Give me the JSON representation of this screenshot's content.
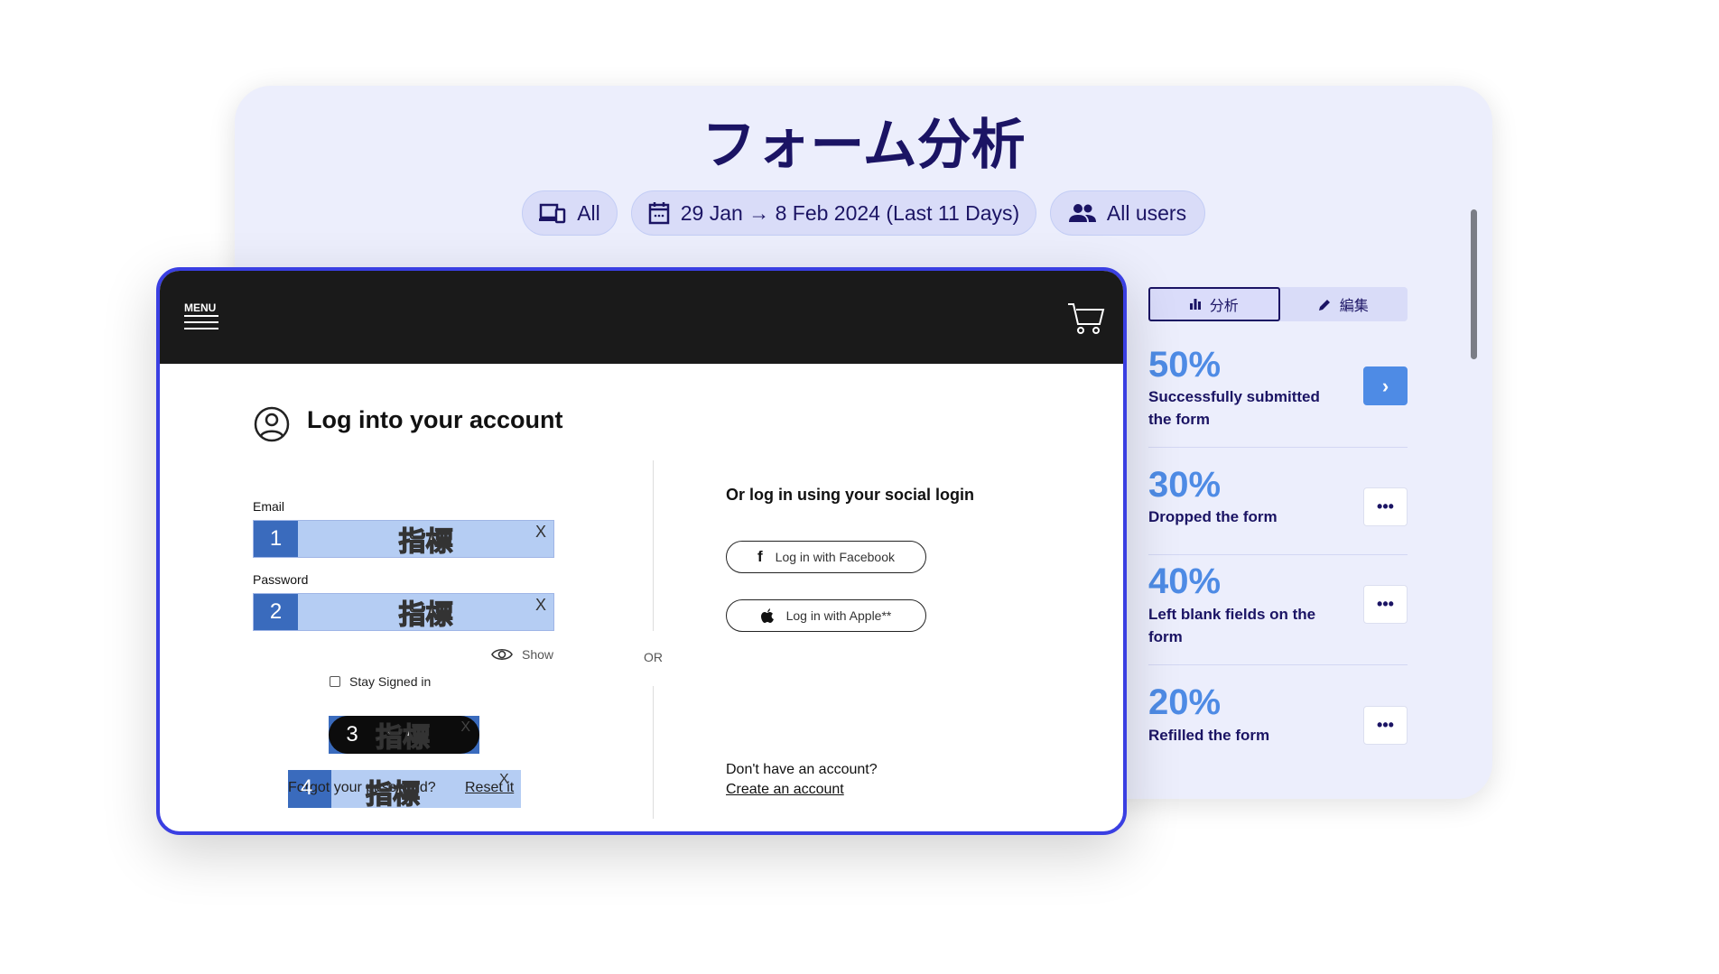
{
  "header": {
    "title": "フォーム分析"
  },
  "filters": [
    {
      "icon": "devices-icon",
      "label": "All"
    },
    {
      "icon": "calendar-icon",
      "label": "29 Jan → 8 Feb 2024 (Last 11 Days)"
    },
    {
      "icon": "users-icon",
      "label": "All users"
    }
  ],
  "tabs": [
    {
      "icon": "bar-chart-icon",
      "label": "分析",
      "active": true
    },
    {
      "icon": "pencil-icon",
      "label": "編集",
      "active": false
    }
  ],
  "stats": [
    {
      "value": "50%",
      "label": "Successfully submitted the form",
      "button": "›"
    },
    {
      "value": "30%",
      "label": "Dropped the form",
      "button": "•••"
    },
    {
      "value": "40%",
      "label": "Left blank fields on the form",
      "button": "•••"
    },
    {
      "value": "20%",
      "label": "Refilled the form",
      "button": "•••"
    }
  ],
  "preview": {
    "menu": "MENU",
    "heading": "Log into your account",
    "email_label": "Email",
    "password_label": "Password",
    "show": "Show",
    "or": "OR",
    "stay_signed": "Stay Signed in",
    "forgot": "Forgot your password?",
    "reset": "Reset it",
    "social_heading": "Or log in using your social login",
    "facebook": "Log in with Facebook",
    "apple": "Log in with Apple**",
    "no_account": "Don't have an account?",
    "create": "Create an account"
  },
  "markers": [
    {
      "num": "1",
      "label": "指標",
      "close": "X"
    },
    {
      "num": "2",
      "label": "指標",
      "close": "X"
    },
    {
      "num": "3",
      "label": "指標",
      "close": "X"
    },
    {
      "num": "4",
      "label": "指標",
      "close": "X"
    }
  ],
  "colors": {
    "accent": "#4e8be5",
    "navy": "#1b1464",
    "frame": "#3a3fe2",
    "marker": "#3a6bbd"
  }
}
